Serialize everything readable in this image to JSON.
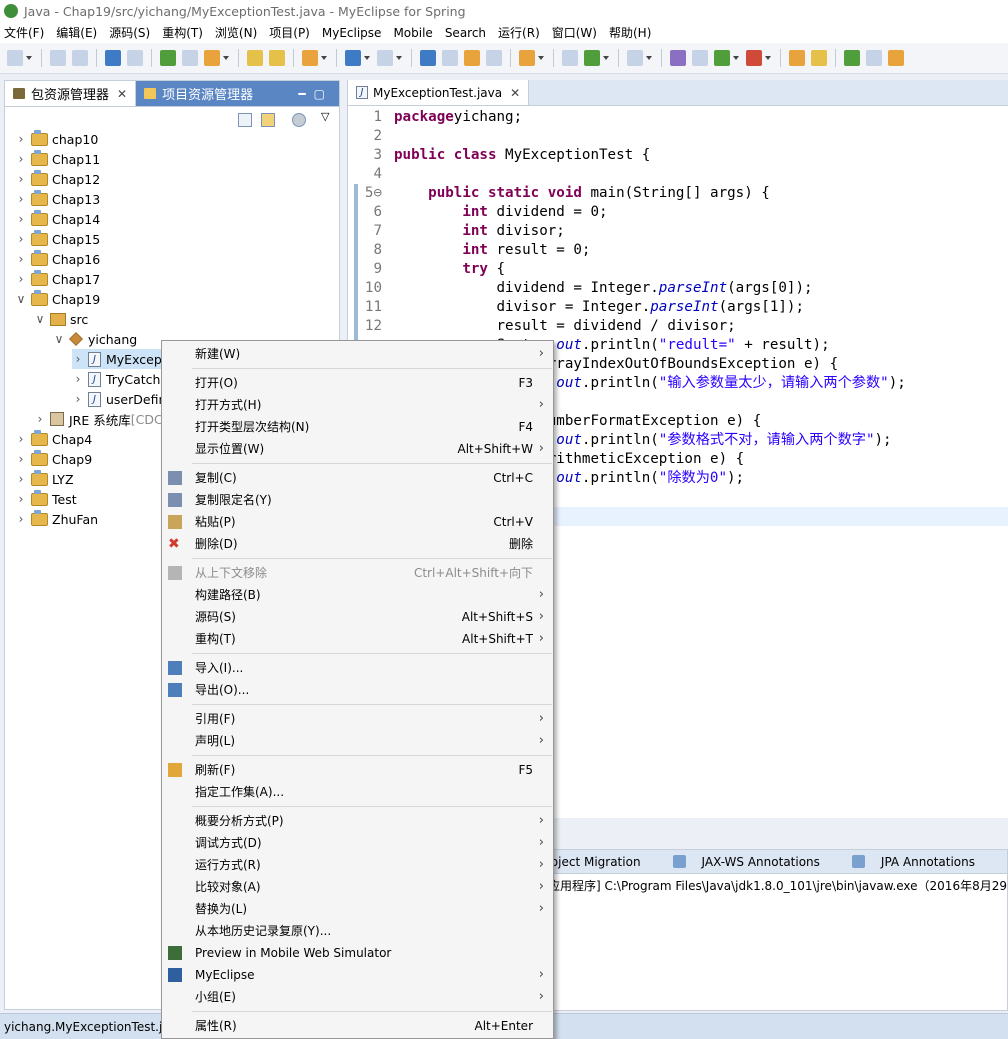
{
  "window": {
    "title": "Java - Chap19/src/yichang/MyExceptionTest.java - MyEclipse for Spring"
  },
  "menubar": [
    "文件(F)",
    "编辑(E)",
    "源码(S)",
    "重构(T)",
    "浏览(N)",
    "项目(P)",
    "MyEclipse",
    "Mobile",
    "Search",
    "运行(R)",
    "窗口(W)",
    "帮助(H)"
  ],
  "left_panel": {
    "tab_active": "包资源管理器",
    "tab_inactive": "项目资源管理器",
    "tree": [
      {
        "label": "chap10",
        "level": 0,
        "type": "project",
        "expanded": false
      },
      {
        "label": "Chap11",
        "level": 0,
        "type": "project",
        "expanded": false
      },
      {
        "label": "Chap12",
        "level": 0,
        "type": "project",
        "expanded": false
      },
      {
        "label": "Chap13",
        "level": 0,
        "type": "project",
        "expanded": false
      },
      {
        "label": "Chap14",
        "level": 0,
        "type": "project",
        "expanded": false
      },
      {
        "label": "Chap15",
        "level": 0,
        "type": "project",
        "expanded": false
      },
      {
        "label": "Chap16",
        "level": 0,
        "type": "project",
        "expanded": false
      },
      {
        "label": "Chap17",
        "level": 0,
        "type": "project",
        "expanded": false
      },
      {
        "label": "Chap19",
        "level": 0,
        "type": "project",
        "expanded": true
      },
      {
        "label": "src",
        "level": 1,
        "type": "src",
        "expanded": true
      },
      {
        "label": "yichang",
        "level": 2,
        "type": "package",
        "expanded": true
      },
      {
        "label": "MyExcep",
        "level": 3,
        "type": "java",
        "expanded": false,
        "selected": true
      },
      {
        "label": "TryCatch",
        "level": 3,
        "type": "java",
        "expanded": false
      },
      {
        "label": "userDefin",
        "level": 3,
        "type": "java",
        "expanded": false
      },
      {
        "label": "JRE 系统库",
        "extra": "[CDC",
        "level": 1,
        "type": "jre",
        "expanded": false
      },
      {
        "label": "Chap4",
        "level": 0,
        "type": "project",
        "expanded": false
      },
      {
        "label": "Chap9",
        "level": 0,
        "type": "project",
        "expanded": false
      },
      {
        "label": "LYZ",
        "level": 0,
        "type": "project",
        "expanded": false
      },
      {
        "label": "Test",
        "level": 0,
        "type": "project",
        "expanded": false
      },
      {
        "label": "ZhuFan",
        "level": 0,
        "type": "project",
        "expanded": false
      }
    ]
  },
  "editor": {
    "tab": "MyExceptionTest.java",
    "lines": [
      {
        "n": "1",
        "segs": [
          [
            "kw",
            "package"
          ],
          [
            "",
            "yichang;"
          ]
        ]
      },
      {
        "n": "2",
        "segs": []
      },
      {
        "n": "3",
        "segs": [
          [
            "kw",
            "public"
          ],
          [
            "",
            " "
          ],
          [
            "kw",
            "class"
          ],
          [
            "",
            " MyExceptionTest {"
          ]
        ]
      },
      {
        "n": "4",
        "segs": []
      },
      {
        "n": "5⊖",
        "segs": [
          [
            "",
            "    "
          ],
          [
            "kw",
            "public"
          ],
          [
            "",
            " "
          ],
          [
            "kw",
            "static"
          ],
          [
            "",
            " "
          ],
          [
            "kw",
            "void"
          ],
          [
            "",
            " main(String[] args) {"
          ]
        ]
      },
      {
        "n": "6",
        "segs": [
          [
            "",
            "        "
          ],
          [
            "kw",
            "int"
          ],
          [
            "",
            " dividend = 0;"
          ]
        ]
      },
      {
        "n": "7",
        "segs": [
          [
            "",
            "        "
          ],
          [
            "kw",
            "int"
          ],
          [
            "",
            " divisor;"
          ]
        ]
      },
      {
        "n": "8",
        "segs": [
          [
            "",
            "        "
          ],
          [
            "kw",
            "int"
          ],
          [
            "",
            " result = 0;"
          ]
        ]
      },
      {
        "n": "9",
        "segs": [
          [
            "",
            "        "
          ],
          [
            "kw",
            "try"
          ],
          [
            "",
            " {"
          ]
        ]
      },
      {
        "n": "10",
        "segs": [
          [
            "",
            "            dividend = Integer."
          ],
          [
            "it",
            "parseInt"
          ],
          [
            "",
            "(args[0]);"
          ]
        ]
      },
      {
        "n": "11",
        "segs": [
          [
            "",
            "            divisor = Integer."
          ],
          [
            "it",
            "parseInt"
          ],
          [
            "",
            "(args[1]);"
          ]
        ]
      },
      {
        "n": "12",
        "segs": [
          [
            "",
            "            result = dividend / divisor;"
          ]
        ]
      },
      {
        "n": "",
        "segs": [
          [
            "",
            "            System."
          ],
          [
            "it",
            "out"
          ],
          [
            "",
            ".println("
          ],
          [
            "st",
            "\"redult=\""
          ],
          [
            "",
            " + result);"
          ]
        ]
      },
      {
        "n": "",
        "segs": [
          [
            "",
            "        } catch (ArrayIndexOutOfBoundsException e) {"
          ]
        ]
      },
      {
        "n": "",
        "segs": [
          [
            "",
            "            System."
          ],
          [
            "it",
            "out"
          ],
          [
            "",
            ".println("
          ],
          [
            "st",
            "\"输入参数量太少，请输入两个参数\""
          ],
          [
            "",
            ");"
          ]
        ]
      },
      {
        "n": "",
        "segs": [
          [
            "",
            "        }"
          ]
        ]
      },
      {
        "n": "",
        "segs": [
          [
            "",
            "        } catch (NumberFormatException e) {"
          ]
        ]
      },
      {
        "n": "",
        "segs": [
          [
            "",
            "            System."
          ],
          [
            "it",
            "out"
          ],
          [
            "",
            ".println("
          ],
          [
            "st",
            "\"参数格式不对，请输入两个数字\""
          ],
          [
            "",
            ");"
          ]
        ]
      },
      {
        "n": "",
        "segs": [
          [
            "",
            "        } catch (ArithmeticException e) {"
          ]
        ]
      },
      {
        "n": "",
        "segs": [
          [
            "",
            "            System."
          ],
          [
            "it",
            "out"
          ],
          [
            "",
            ".println("
          ],
          [
            "st",
            "\"除数为0\""
          ],
          [
            "",
            ");"
          ]
        ]
      }
    ]
  },
  "bottom_panel": {
    "tabs": [
      "控制台",
      "Project Migration",
      "JAX-WS Annotations",
      "JPA Annotations"
    ],
    "console_line": "应用程序] C:\\Program Files\\Java\\jdk1.8.0_101\\jre\\bin\\javaw.exe（2016年8月29日"
  },
  "status_bar": "yichang.MyExceptionTest.java",
  "context_menu": {
    "items": [
      {
        "label": "新建(W)",
        "shortcut": "",
        "submenu": true
      },
      {
        "sep": true
      },
      {
        "label": "打开(O)",
        "shortcut": "F3"
      },
      {
        "label": "打开方式(H)",
        "shortcut": "",
        "submenu": true
      },
      {
        "label": "打开类型层次结构(N)",
        "shortcut": "F4"
      },
      {
        "label": "显示位置(W)",
        "shortcut": "Alt+Shift+W",
        "submenu": true
      },
      {
        "sep": true
      },
      {
        "label": "复制(C)",
        "shortcut": "Ctrl+C",
        "icon": "copy-icon"
      },
      {
        "label": "复制限定名(Y)",
        "shortcut": "",
        "icon": "copy-qualified-icon"
      },
      {
        "label": "粘贴(P)",
        "shortcut": "Ctrl+V",
        "icon": "paste-icon"
      },
      {
        "label": "删除(D)",
        "shortcut": "删除",
        "icon": "delete-icon"
      },
      {
        "sep": true
      },
      {
        "label": "从上下文移除",
        "shortcut": "Ctrl+Alt+Shift+向下",
        "disabled": true,
        "icon": "remove-context-icon"
      },
      {
        "label": "构建路径(B)",
        "shortcut": "",
        "submenu": true
      },
      {
        "label": "源码(S)",
        "shortcut": "Alt+Shift+S",
        "submenu": true
      },
      {
        "label": "重构(T)",
        "shortcut": "Alt+Shift+T",
        "submenu": true
      },
      {
        "sep": true
      },
      {
        "label": "导入(I)...",
        "shortcut": "",
        "icon": "import-icon"
      },
      {
        "label": "导出(O)...",
        "shortcut": "",
        "icon": "export-icon"
      },
      {
        "sep": true
      },
      {
        "label": "引用(F)",
        "shortcut": "",
        "submenu": true
      },
      {
        "label": "声明(L)",
        "shortcut": "",
        "submenu": true
      },
      {
        "sep": true
      },
      {
        "label": "刷新(F)",
        "shortcut": "F5",
        "icon": "refresh-icon"
      },
      {
        "label": "指定工作集(A)...",
        "shortcut": ""
      },
      {
        "sep": true
      },
      {
        "label": "概要分析方式(P)",
        "shortcut": "",
        "submenu": true
      },
      {
        "label": "调试方式(D)",
        "shortcut": "",
        "submenu": true
      },
      {
        "label": "运行方式(R)",
        "shortcut": "",
        "submenu": true
      },
      {
        "label": "比较对象(A)",
        "shortcut": "",
        "submenu": true
      },
      {
        "label": "替换为(L)",
        "shortcut": "",
        "submenu": true
      },
      {
        "label": "从本地历史记录复原(Y)...",
        "shortcut": ""
      },
      {
        "label": "Preview in Mobile Web Simulator",
        "shortcut": "",
        "icon": "mobile-icon"
      },
      {
        "label": "MyEclipse",
        "shortcut": "",
        "submenu": true,
        "icon": "myeclipse-icon"
      },
      {
        "label": "小组(E)",
        "shortcut": "",
        "submenu": true
      },
      {
        "sep": true
      },
      {
        "label": "属性(R)",
        "shortcut": "Alt+Enter"
      }
    ]
  },
  "colors": {
    "accent": "#5a86c4",
    "keyword": "#7f0055",
    "string": "#2a00ff"
  }
}
